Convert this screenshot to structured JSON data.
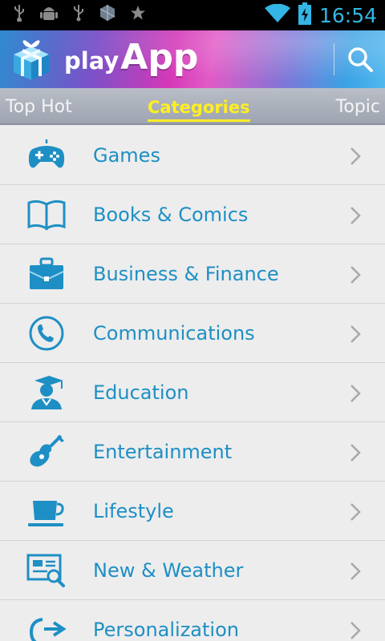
{
  "status_bar": {
    "time": "16:54",
    "left_icons": [
      "usb-icon",
      "android-debug-icon",
      "usb-icon",
      "app-notification-icon",
      "star-icon"
    ],
    "right_icons": [
      "wifi-icon",
      "battery-charging-icon"
    ]
  },
  "header": {
    "brand_play": "play",
    "brand_app": "App",
    "logo_icon": "gift-box-logo-icon",
    "search_icon": "search-icon"
  },
  "tabs": [
    {
      "label": "Top Hot",
      "selected": false
    },
    {
      "label": "Categories",
      "selected": true
    },
    {
      "label": "Topic",
      "selected": false
    }
  ],
  "colors": {
    "accent": "#1e8fc4",
    "tab_selected": "#ffee22",
    "status_accent": "#33b5e5",
    "list_bg": "#ededed"
  },
  "categories": [
    {
      "label": "Games",
      "icon": "gamepad-icon"
    },
    {
      "label": "Books & Comics",
      "icon": "open-book-icon"
    },
    {
      "label": "Business & Finance",
      "icon": "briefcase-icon"
    },
    {
      "label": "Communications",
      "icon": "phone-icon"
    },
    {
      "label": "Education",
      "icon": "graduate-icon"
    },
    {
      "label": "Entertainment",
      "icon": "guitar-icon"
    },
    {
      "label": "Lifestyle",
      "icon": "cup-icon"
    },
    {
      "label": "New & Weather",
      "icon": "news-search-icon"
    },
    {
      "label": "Personalization",
      "icon": "personalization-icon"
    }
  ]
}
